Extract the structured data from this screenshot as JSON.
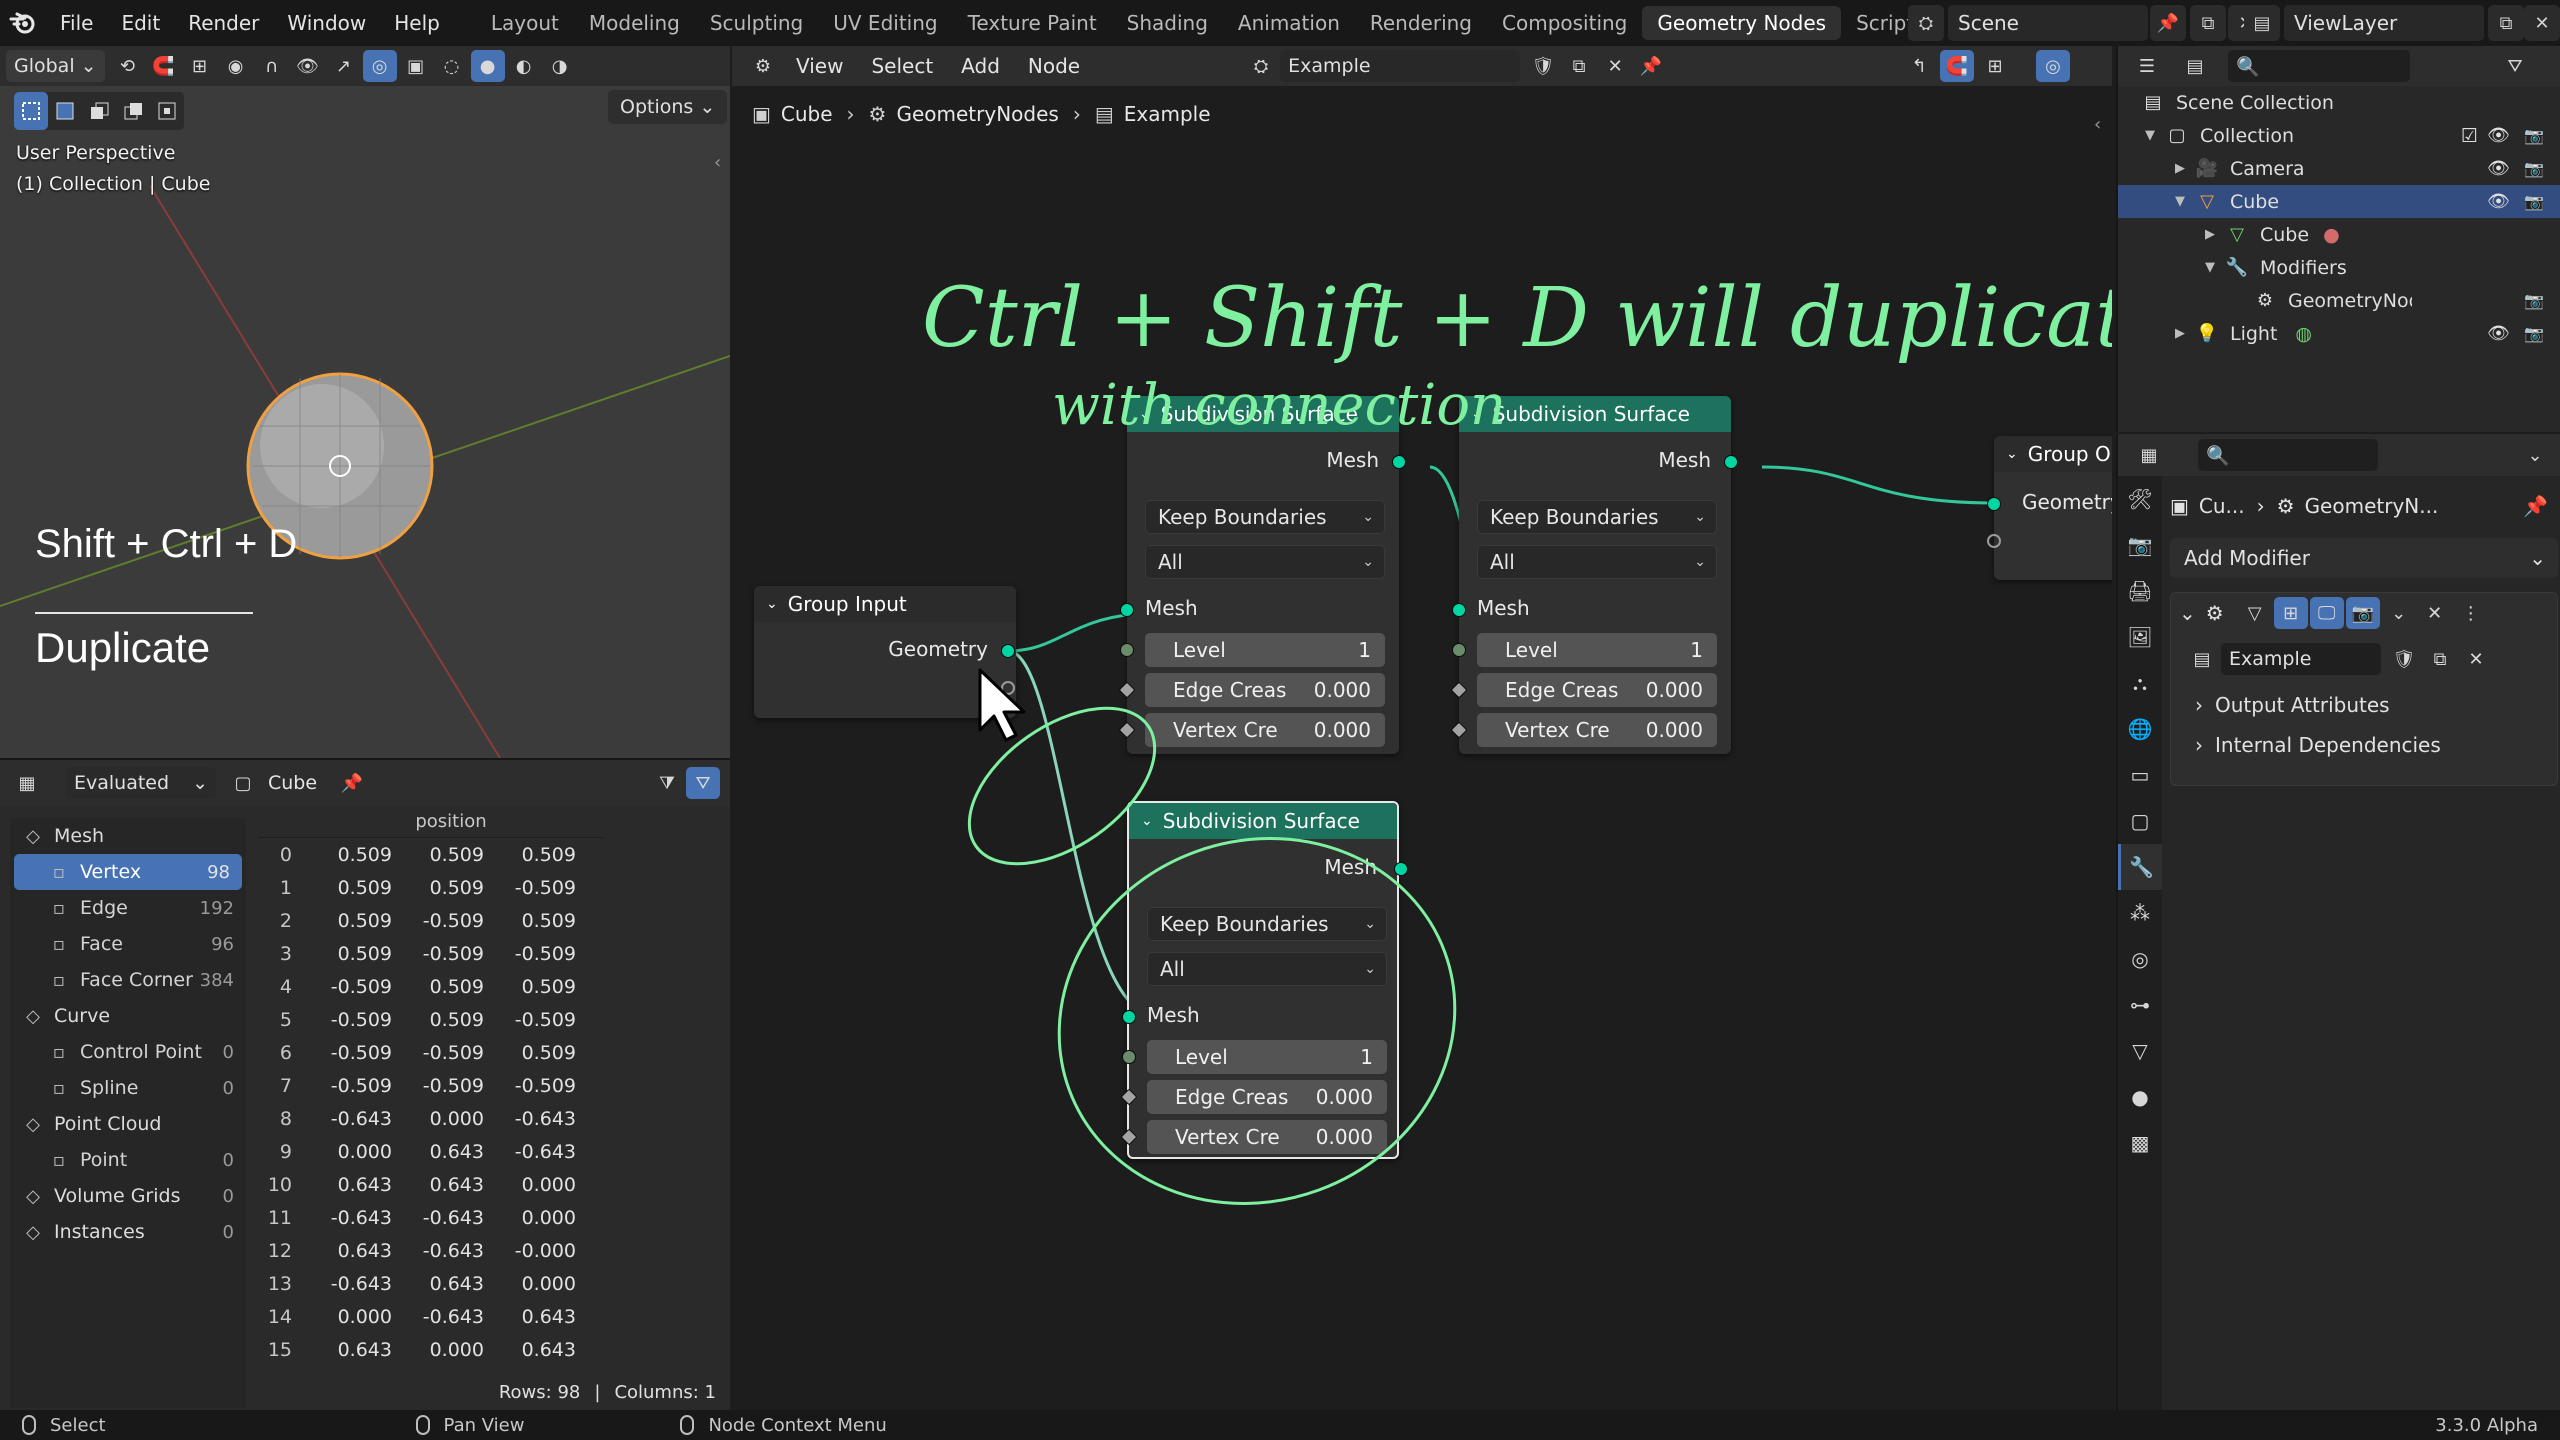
{
  "topbar": {
    "menus": [
      "File",
      "Edit",
      "Render",
      "Window",
      "Help"
    ],
    "workspaces": [
      "Layout",
      "Modeling",
      "Sculpting",
      "UV Editing",
      "Texture Paint",
      "Shading",
      "Animation",
      "Rendering",
      "Compositing",
      "Geometry Nodes",
      "Scripting"
    ],
    "active_workspace": "Geometry Nodes",
    "add_tab": "+",
    "scene": "Scene",
    "view_layer": "ViewLayer"
  },
  "viewport": {
    "orientation": "Global",
    "options_label": "Options",
    "view_name": "User Perspective",
    "context": "(1) Collection | Cube",
    "shortcut_overlay": "Shift + Ctrl + D",
    "action_overlay": "Duplicate"
  },
  "spreadsheet": {
    "mode": "Evaluated",
    "object": "Cube",
    "column_header": "position",
    "groups": [
      {
        "label": "Mesh",
        "icon": "mesh-icon",
        "items": [
          {
            "label": "Vertex",
            "count": "98",
            "icon": "vertex-icon",
            "active": true
          },
          {
            "label": "Edge",
            "count": "192",
            "icon": "edge-icon"
          },
          {
            "label": "Face",
            "count": "96",
            "icon": "face-icon"
          },
          {
            "label": "Face Corner",
            "count": "384",
            "icon": "face-corner-icon"
          }
        ]
      },
      {
        "label": "Curve",
        "icon": "curve-icon",
        "items": [
          {
            "label": "Control Point",
            "count": "0",
            "icon": "control-point-icon"
          },
          {
            "label": "Spline",
            "count": "0",
            "icon": "spline-icon"
          }
        ]
      },
      {
        "label": "Point Cloud",
        "icon": "point-cloud-icon",
        "items": [
          {
            "label": "Point",
            "count": "0",
            "icon": "point-icon"
          }
        ]
      },
      {
        "label": "Volume Grids",
        "count": "0",
        "icon": "volume-icon",
        "items": []
      },
      {
        "label": "Instances",
        "count": "0",
        "icon": "instances-icon",
        "items": []
      }
    ],
    "rows": [
      [
        "0",
        "0.509",
        "0.509",
        "0.509"
      ],
      [
        "1",
        "0.509",
        "0.509",
        "-0.509"
      ],
      [
        "2",
        "0.509",
        "-0.509",
        "0.509"
      ],
      [
        "3",
        "0.509",
        "-0.509",
        "-0.509"
      ],
      [
        "4",
        "-0.509",
        "0.509",
        "0.509"
      ],
      [
        "5",
        "-0.509",
        "0.509",
        "-0.509"
      ],
      [
        "6",
        "-0.509",
        "-0.509",
        "0.509"
      ],
      [
        "7",
        "-0.509",
        "-0.509",
        "-0.509"
      ],
      [
        "8",
        "-0.643",
        "0.000",
        "-0.643"
      ],
      [
        "9",
        "0.000",
        "0.643",
        "-0.643"
      ],
      [
        "10",
        "0.643",
        "0.643",
        "0.000"
      ],
      [
        "11",
        "-0.643",
        "-0.643",
        "0.000"
      ],
      [
        "12",
        "0.643",
        "-0.643",
        "-0.000"
      ],
      [
        "13",
        "-0.643",
        "0.643",
        "0.000"
      ],
      [
        "14",
        "0.000",
        "-0.643",
        "0.643"
      ],
      [
        "15",
        "0.643",
        "0.000",
        "0.643"
      ]
    ],
    "footer_rows": "Rows: 98",
    "footer_sep": "|",
    "footer_cols": "Columns: 1"
  },
  "node_editor": {
    "menus": [
      "View",
      "Select",
      "Add",
      "Node"
    ],
    "node_tree": "Example",
    "breadcrumb": [
      "Cube",
      "GeometryNodes",
      "Example"
    ],
    "annotation_line1": "Ctrl + Shift + D  will  duplicate",
    "annotation_line2": "with  connection",
    "group_input": {
      "title": "Group Input",
      "socket": "Geometry"
    },
    "group_output": {
      "title": "Group O",
      "socket": "Geometry"
    },
    "subdiv_nodes": [
      {
        "title": "Subdivision Surface",
        "out": "Mesh",
        "boundary": "Keep Boundaries",
        "uv": "All",
        "in": "Mesh",
        "level_label": "Level",
        "level": "1",
        "edge_label": "Edge Creas",
        "edge": "0.000",
        "vertex_label": "Vertex Cre",
        "vertex": "0.000"
      },
      {
        "title": "Subdivision Surface",
        "out": "Mesh",
        "boundary": "Keep Boundaries",
        "uv": "All",
        "in": "Mesh",
        "level_label": "Level",
        "level": "1",
        "edge_label": "Edge Creas",
        "edge": "0.000",
        "vertex_label": "Vertex Cre",
        "vertex": "0.000"
      },
      {
        "title": "Subdivision Surface",
        "out": "Mesh",
        "boundary": "Keep Boundaries",
        "uv": "All",
        "in": "Mesh",
        "level_label": "Level",
        "level": "1",
        "edge_label": "Edge Creas",
        "edge": "0.000",
        "vertex_label": "Vertex Cre",
        "vertex": "0.000"
      }
    ]
  },
  "outliner": {
    "title": "Scene Collection",
    "items": [
      {
        "label": "Collection",
        "icon": "collection-icon"
      },
      {
        "label": "Camera",
        "icon": "camera-icon"
      },
      {
        "label": "Cube",
        "icon": "cube-object-icon",
        "active": true
      },
      {
        "label": "Cube",
        "icon": "mesh-data-icon"
      },
      {
        "label": "Modifiers",
        "icon": "wrench-icon"
      },
      {
        "label": "GeometryNodes",
        "icon": "geometry-nodes-icon"
      },
      {
        "label": "Light",
        "icon": "light-icon"
      }
    ]
  },
  "properties": {
    "breadcrumb_object": "Cu...",
    "breadcrumb_modifier": "GeometryN...",
    "add_modifier": "Add Modifier",
    "node_group": "Example",
    "output_attributes": "Output Attributes",
    "internal_dependencies": "Internal Dependencies"
  },
  "statusbar": {
    "select": "Select",
    "pan": "Pan View",
    "context_menu": "Node Context Menu",
    "version": "3.3.0 Alpha"
  },
  "colors": {
    "accent": "#4772b3",
    "node_header": "#1d725e",
    "geometry_socket": "#00d6a3",
    "annotation": "#7ef0a0",
    "selected_object": "#f0a040"
  }
}
